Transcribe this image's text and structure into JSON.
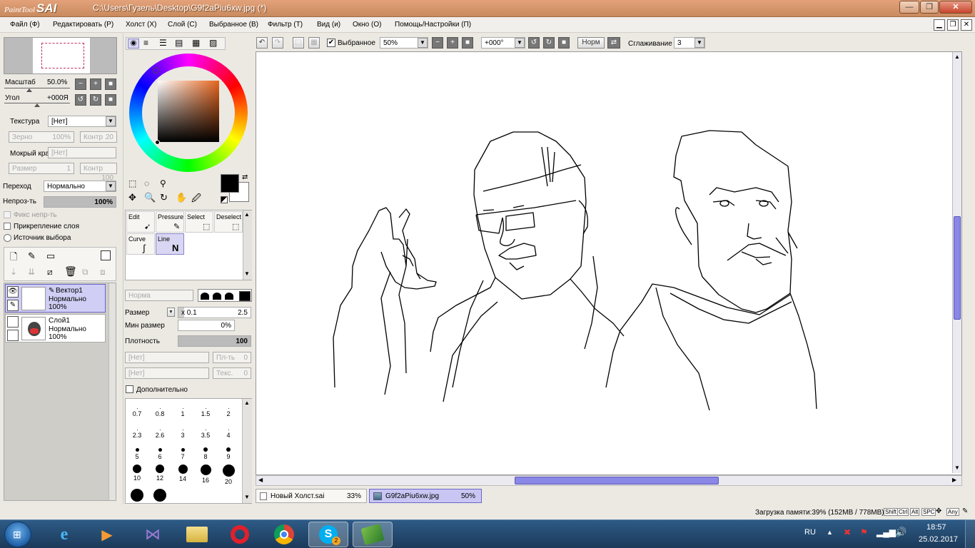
{
  "app": {
    "logo_small": "PaintTool",
    "logo_big": "SAI",
    "title": "C:\\Users\\Гузель\\Desktop\\G9f2aPiu6xw.jpg (*)"
  },
  "menu": [
    "Файл (Ф)",
    "Редактировать (Р)",
    "Холст (Х)",
    "Слой (С)",
    "Выбранное (В)",
    "Фильтр (Т)",
    "Вид (и)",
    "Окно (О)",
    "Помощь/Настройки (П)"
  ],
  "navigator": {
    "scale_label": "Масштаб",
    "scale_value": "50.0%",
    "angle_label": "Угол",
    "angle_value": "+000Я"
  },
  "texture": {
    "label": "Текстура",
    "value": "[Нет]",
    "grain_label": "Зерно",
    "grain_value": "100%",
    "contrast_label": "Контр",
    "contrast_value": "20",
    "wet_label": "Мокрый край",
    "wet_value": "[Нет]",
    "size_label": "Размер",
    "size_value": "1",
    "contrast2_label": "Контр",
    "contrast2_value": "100"
  },
  "blend": {
    "label": "Переход",
    "value": "Нормально",
    "opacity_label": "Непроз-ть",
    "opacity_value": "100%"
  },
  "checks": {
    "fix_opacity": "Фикс непр-ть",
    "clip_layer": "Прикрепление слоя",
    "sel_source": "Источник выбора"
  },
  "layers": [
    {
      "name": "Вектор1",
      "mode": "Нормально",
      "opacity": "100%"
    },
    {
      "name": "Слой1",
      "mode": "Нормально",
      "opacity": "100%"
    }
  ],
  "tools": [
    {
      "label": "Edit"
    },
    {
      "label": "Pressure"
    },
    {
      "label": "Select"
    },
    {
      "label": "Deselect"
    },
    {
      "label": "Curve"
    },
    {
      "label": "Line"
    }
  ],
  "brush": {
    "mode_value": "Норма",
    "size_label": "Размер",
    "size_mult": "x 0.1",
    "size_value": "2.5",
    "minsize_label": "Мин размер",
    "minsize_value": "0%",
    "density_label": "Плотность",
    "density_value": "100",
    "tex1_value": "[Нет]",
    "tex1_label": "Пл-ть",
    "tex1_num": "0",
    "tex2_value": "[Нет]",
    "tex2_label": "Текс.",
    "tex2_num": "0",
    "advanced_label": "Дополнительно"
  },
  "brush_sizes": [
    "0.7",
    "0.8",
    "1",
    "1.5",
    "2",
    "2.3",
    "2.6",
    "3",
    "3.5",
    "4",
    "5",
    "6",
    "7",
    "8",
    "9",
    "10",
    "12",
    "14",
    "16",
    "20"
  ],
  "toolbar": {
    "selected_label": "Выбранное",
    "zoom_value": "50%",
    "angle_value": "+000°",
    "norm_label": "Норм",
    "smoothing_label": "Сглаживание",
    "smoothing_value": "3"
  },
  "tabs": [
    {
      "name": "Новый Холст.sai",
      "zoom": "33%"
    },
    {
      "name": "G9f2aPiu6xw.jpg",
      "zoom": "50%"
    }
  ],
  "status": {
    "memory": "Загрузка памяти:39% (152MB / 778MB)",
    "keys": [
      "Shift",
      "Ctrl",
      "Alt",
      "SPC",
      "Any"
    ]
  },
  "taskbar": {
    "lang": "RU",
    "time": "18:57",
    "date": "25.02.2017",
    "skype_badge": "2"
  },
  "colors": {
    "accent": "#8a87e6",
    "title": "#d49570",
    "taskbar": "#24486d"
  }
}
